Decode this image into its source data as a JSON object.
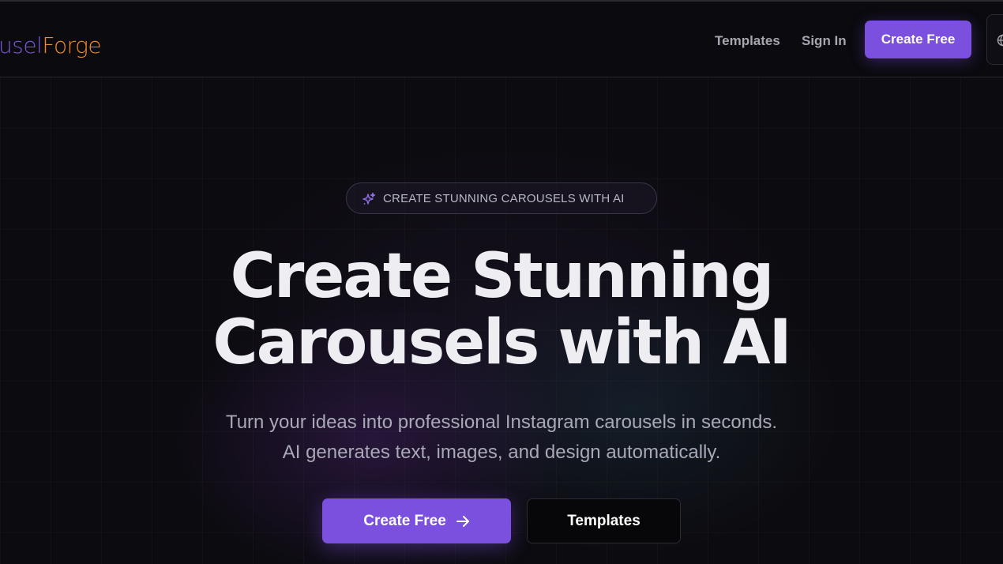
{
  "header": {
    "logo_part1": "usel",
    "logo_part2": "Forge",
    "nav": {
      "templates_label": "Templates",
      "signin_label": "Sign In",
      "cta_label": "Create Free"
    },
    "language_icon": "globe-icon"
  },
  "hero": {
    "badge_icon": "sparkles-icon",
    "badge_text": "CREATE STUNNING CAROUSELS WITH AI",
    "headline_line1": "Create Stunning",
    "headline_line2": "Carousels with AI",
    "subtitle_line1": "Turn your ideas into professional Instagram carousels in seconds.",
    "subtitle_line2": "AI generates text, images, and design automatically.",
    "primary_cta_label": "Create Free",
    "primary_cta_icon": "arrow-right-icon",
    "secondary_cta_label": "Templates"
  },
  "colors": {
    "accent": "#7b50de",
    "logo_purple": "#7b57d8",
    "logo_orange": "#f08a2a",
    "background": "#0c0b10"
  }
}
